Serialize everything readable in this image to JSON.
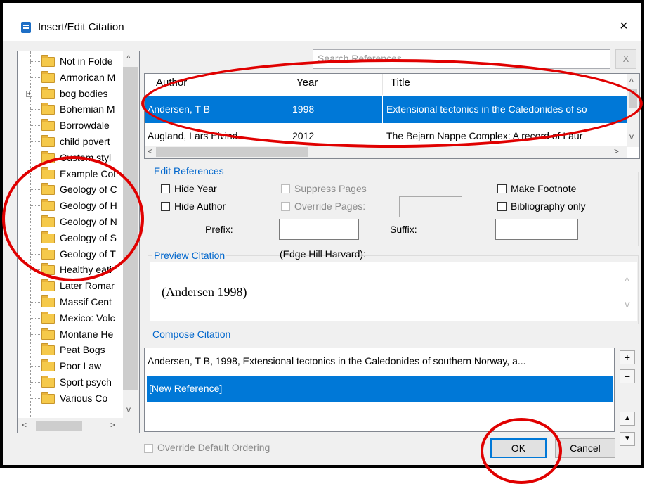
{
  "window": {
    "title": "Insert/Edit Citation",
    "close": "×"
  },
  "tree": {
    "items": [
      "Not in Folde",
      "Armorican M",
      "bog bodies",
      "Bohemian M",
      "Borrowdale",
      "child povert",
      "Custom styl",
      "Example Col",
      "Geology of C",
      "Geology of H",
      "Geology of N",
      "Geology of S",
      "Geology of T",
      "Healthy eati",
      "Later Romar",
      "Massif Cent",
      "Mexico: Volc",
      "Montane He",
      "Peat Bogs",
      "Poor Law",
      "Sport psych",
      "Various Co"
    ]
  },
  "search": {
    "placeholder": "Search References",
    "clear": "X"
  },
  "refs": {
    "columns": [
      "Author",
      "Year",
      "Title"
    ],
    "rows": [
      {
        "author": "Andersen, T B",
        "year": "1998",
        "title": "Extensional tectonics in the Caledonides of so"
      },
      {
        "author": "Augland, Lars Eivind",
        "year": "2012",
        "title": "The Bejarn Nappe Complex: A record of Laur"
      }
    ]
  },
  "edit": {
    "title": "Edit References",
    "hide_year": "Hide Year",
    "hide_author": "Hide Author",
    "suppress_pages": "Suppress Pages",
    "override_pages": "Override Pages:",
    "make_footnote": "Make Footnote",
    "bibliography_only": "Bibliography only",
    "prefix": "Prefix:",
    "suffix": "Suffix:"
  },
  "preview": {
    "title": "Preview Citation",
    "style": "(Edge Hill Harvard):",
    "text": "(Andersen 1998)"
  },
  "compose": {
    "title": "Compose Citation",
    "items": [
      "Andersen, T B, 1998, Extensional tectonics in the Caledonides of southern Norway, a...",
      "[New Reference]"
    ],
    "side_buttons": [
      "+",
      "−",
      "▲",
      "▼"
    ]
  },
  "footer": {
    "override_ordering": "Override Default Ordering",
    "ok": "OK",
    "cancel": "Cancel"
  },
  "colors": {
    "selection": "#0078d7",
    "annotation": "#e00000"
  }
}
